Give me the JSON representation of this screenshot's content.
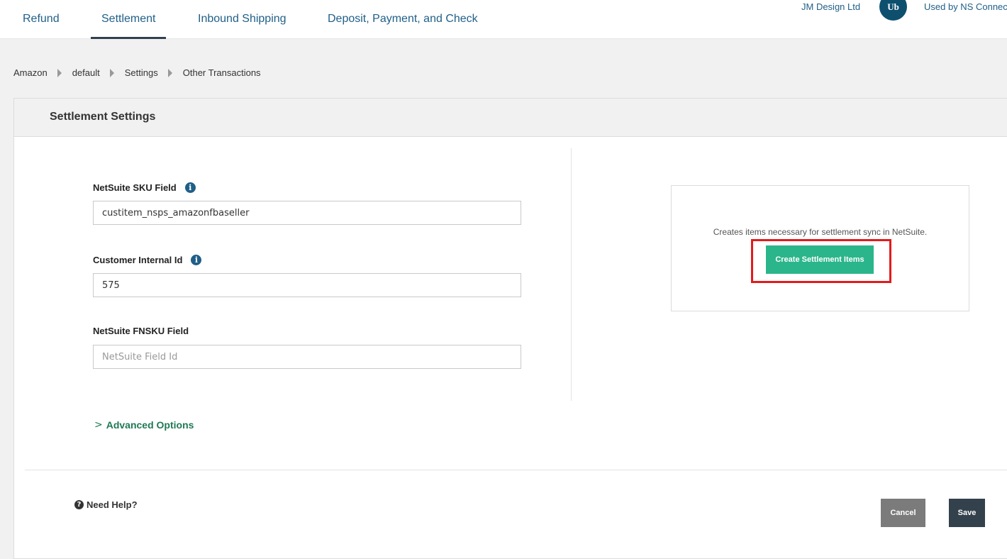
{
  "tabs": [
    {
      "label": "Refund"
    },
    {
      "label": "Settlement"
    },
    {
      "label": "Inbound Shipping"
    },
    {
      "label": "Deposit, Payment, and Check"
    }
  ],
  "account": {
    "name": "JM Design Ltd",
    "avatar_initials": "Ub",
    "used_by": "Used by NS Connecto"
  },
  "breadcrumb": [
    "Amazon",
    "default",
    "Settings",
    "Other Transactions"
  ],
  "panel": {
    "title": "Settlement Settings",
    "fields": {
      "sku": {
        "label": "NetSuite SKU Field",
        "value": "custitem_nsps_amazonfbaseller"
      },
      "customer": {
        "label": "Customer Internal Id",
        "value": "575"
      },
      "fnsku": {
        "label": "NetSuite FNSKU Field",
        "value": "",
        "placeholder": "NetSuite Field Id"
      }
    },
    "create": {
      "description": "Creates items necessary for settlement sync in NetSuite.",
      "button_label": "Create Settlement Items"
    },
    "advanced_label": "Advanced Options",
    "help_label": "Need Help?",
    "cancel_label": "Cancel",
    "save_label": "Save"
  },
  "colors": {
    "accent": "#2bb58a",
    "highlight": "#e31b1b",
    "primary": "#33414d"
  }
}
